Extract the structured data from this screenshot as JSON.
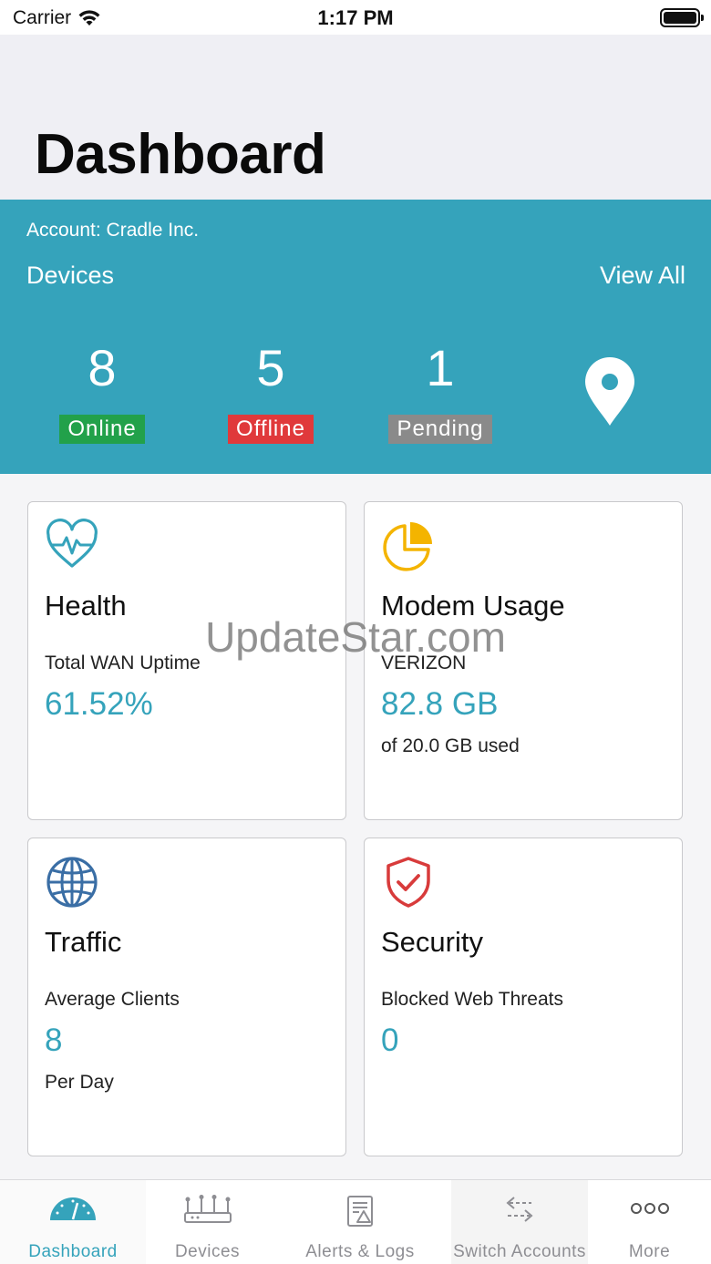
{
  "status_bar": {
    "carrier": "Carrier",
    "time": "1:17 PM"
  },
  "header": {
    "title": "Dashboard"
  },
  "summary": {
    "account": "Account: Cradle Inc.",
    "section_label": "Devices",
    "view_all": "View All",
    "online": {
      "count": "8",
      "label": "Online"
    },
    "offline": {
      "count": "5",
      "label": "Offline"
    },
    "pending": {
      "count": "1",
      "label": "Pending"
    }
  },
  "cards": {
    "health": {
      "title": "Health",
      "label": "Total WAN Uptime",
      "value": "61.52%"
    },
    "modem": {
      "title": "Modem Usage",
      "label": "VERIZON",
      "value": "82.8 GB",
      "sub": "of 20.0 GB used"
    },
    "traffic": {
      "title": "Traffic",
      "label": "Average Clients",
      "value": "8",
      "sub": "Per Day"
    },
    "security": {
      "title": "Security",
      "label": "Blocked Web Threats",
      "value": "0"
    }
  },
  "watermark": "UpdateStar.com",
  "tabs": [
    {
      "label": "Dashboard",
      "icon": "speedometer-icon"
    },
    {
      "label": "Devices",
      "icon": "router-icon"
    },
    {
      "label": "Alerts & Logs",
      "icon": "log-document-icon"
    },
    {
      "label": "Switch Accounts",
      "icon": "swap-arrows-icon"
    },
    {
      "label": "More",
      "icon": "more-dots-icon"
    }
  ],
  "colors": {
    "accent": "#35a3bb",
    "online": "#22a14a",
    "offline": "#e0393b",
    "pending": "#8a8a8a",
    "health_icon": "#35a3bb",
    "modem_icon": "#f4b400",
    "traffic_icon": "#3a6ea5",
    "security_icon": "#d83b3b"
  }
}
